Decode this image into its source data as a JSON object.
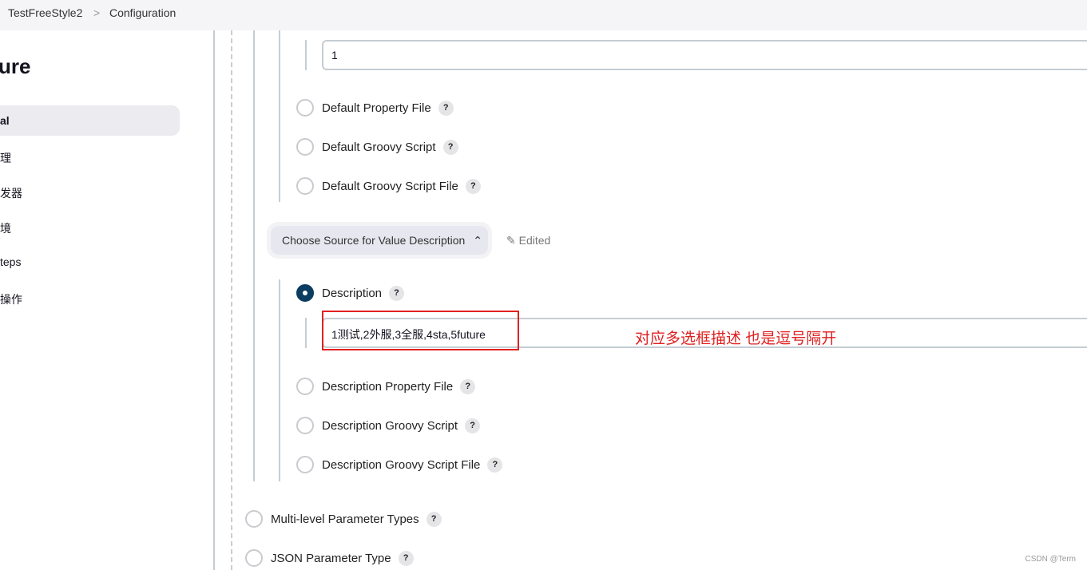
{
  "breadcrumb": {
    "items": [
      "TestFreeStyle2",
      "Configuration"
    ],
    "separator": ">"
  },
  "sidebar": {
    "title": "ure",
    "items": [
      {
        "label": "al",
        "active": true
      },
      {
        "label": "理"
      },
      {
        "label": "发器"
      },
      {
        "label": "境"
      },
      {
        "label": "teps"
      },
      {
        "label": "操作"
      }
    ]
  },
  "value_input": {
    "value": "1"
  },
  "value_options": [
    "Default Property File",
    "Default Groovy Script",
    "Default Groovy Script File"
  ],
  "description_chooser": {
    "label": "Choose Source for Value Description",
    "edited": "Edited"
  },
  "description_options": [
    {
      "label": "Description",
      "selected": true
    },
    {
      "label": "Description Property File"
    },
    {
      "label": "Description Groovy Script"
    },
    {
      "label": "Description Groovy Script File"
    }
  ],
  "description_input": {
    "value": "1测试,2外服,3全服,4sta,5future"
  },
  "annotation": "对应多选框描述 也是逗号隔开",
  "param_types": [
    "Multi-level Parameter Types",
    "JSON Parameter Type"
  ],
  "help": "?",
  "watermark": "CSDN @Term",
  "colors": {
    "radio_selected": "#0b3d61",
    "annotation": "#e02020"
  }
}
